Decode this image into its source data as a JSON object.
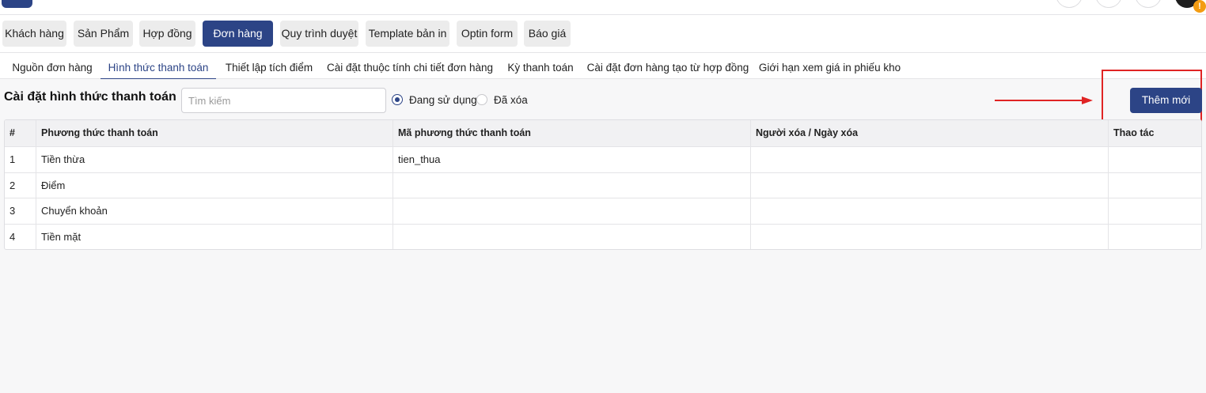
{
  "topbar": {
    "notification_badge": "!"
  },
  "modules": [
    {
      "label": "Khách hàng",
      "active": false
    },
    {
      "label": "Sản Phẩm",
      "active": false
    },
    {
      "label": "Hợp đồng",
      "active": false
    },
    {
      "label": "Đơn hàng",
      "active": true
    },
    {
      "label": "Quy trình duyệt",
      "active": false
    },
    {
      "label": "Template bản in",
      "active": false
    },
    {
      "label": "Optin form",
      "active": false
    },
    {
      "label": "Báo giá",
      "active": false
    }
  ],
  "subtabs": [
    {
      "label": "Nguồn đơn hàng",
      "active": false
    },
    {
      "label": "Hình thức thanh toán",
      "active": true
    },
    {
      "label": "Thiết lập tích điểm",
      "active": false
    },
    {
      "label": "Cài đặt thuộc tính chi tiết đơn hàng",
      "active": false
    },
    {
      "label": "Kỳ thanh toán",
      "active": false
    },
    {
      "label": "Cài đặt đơn hàng tạo từ hợp đồng",
      "active": false
    },
    {
      "label": "Giới hạn xem giá in phiếu kho",
      "active": false
    }
  ],
  "toolbar": {
    "title": "Cài đặt hình thức thanh toán",
    "search_placeholder": "Tìm kiếm",
    "search_value": "",
    "filter_in_use": "Đang sử dụng",
    "filter_deleted": "Đã xóa",
    "selected_filter": "Đang sử dụng",
    "add_label": "Thêm mới"
  },
  "table": {
    "columns": [
      "#",
      "Phương thức thanh toán",
      "Mã phương thức thanh toán",
      "Người xóa / Ngày xóa",
      "Thao tác"
    ],
    "rows": [
      [
        "1",
        "Tiền thừa",
        "tien_thua",
        "",
        ""
      ],
      [
        "2",
        "Điểm",
        "",
        "",
        ""
      ],
      [
        "3",
        "Chuyển khoản",
        "",
        "",
        ""
      ],
      [
        "4",
        "Tiền mặt",
        "",
        "",
        ""
      ]
    ]
  },
  "colors": {
    "primary": "#2c4486",
    "annotation_red": "#e02424",
    "badge_orange": "#f39c12"
  }
}
